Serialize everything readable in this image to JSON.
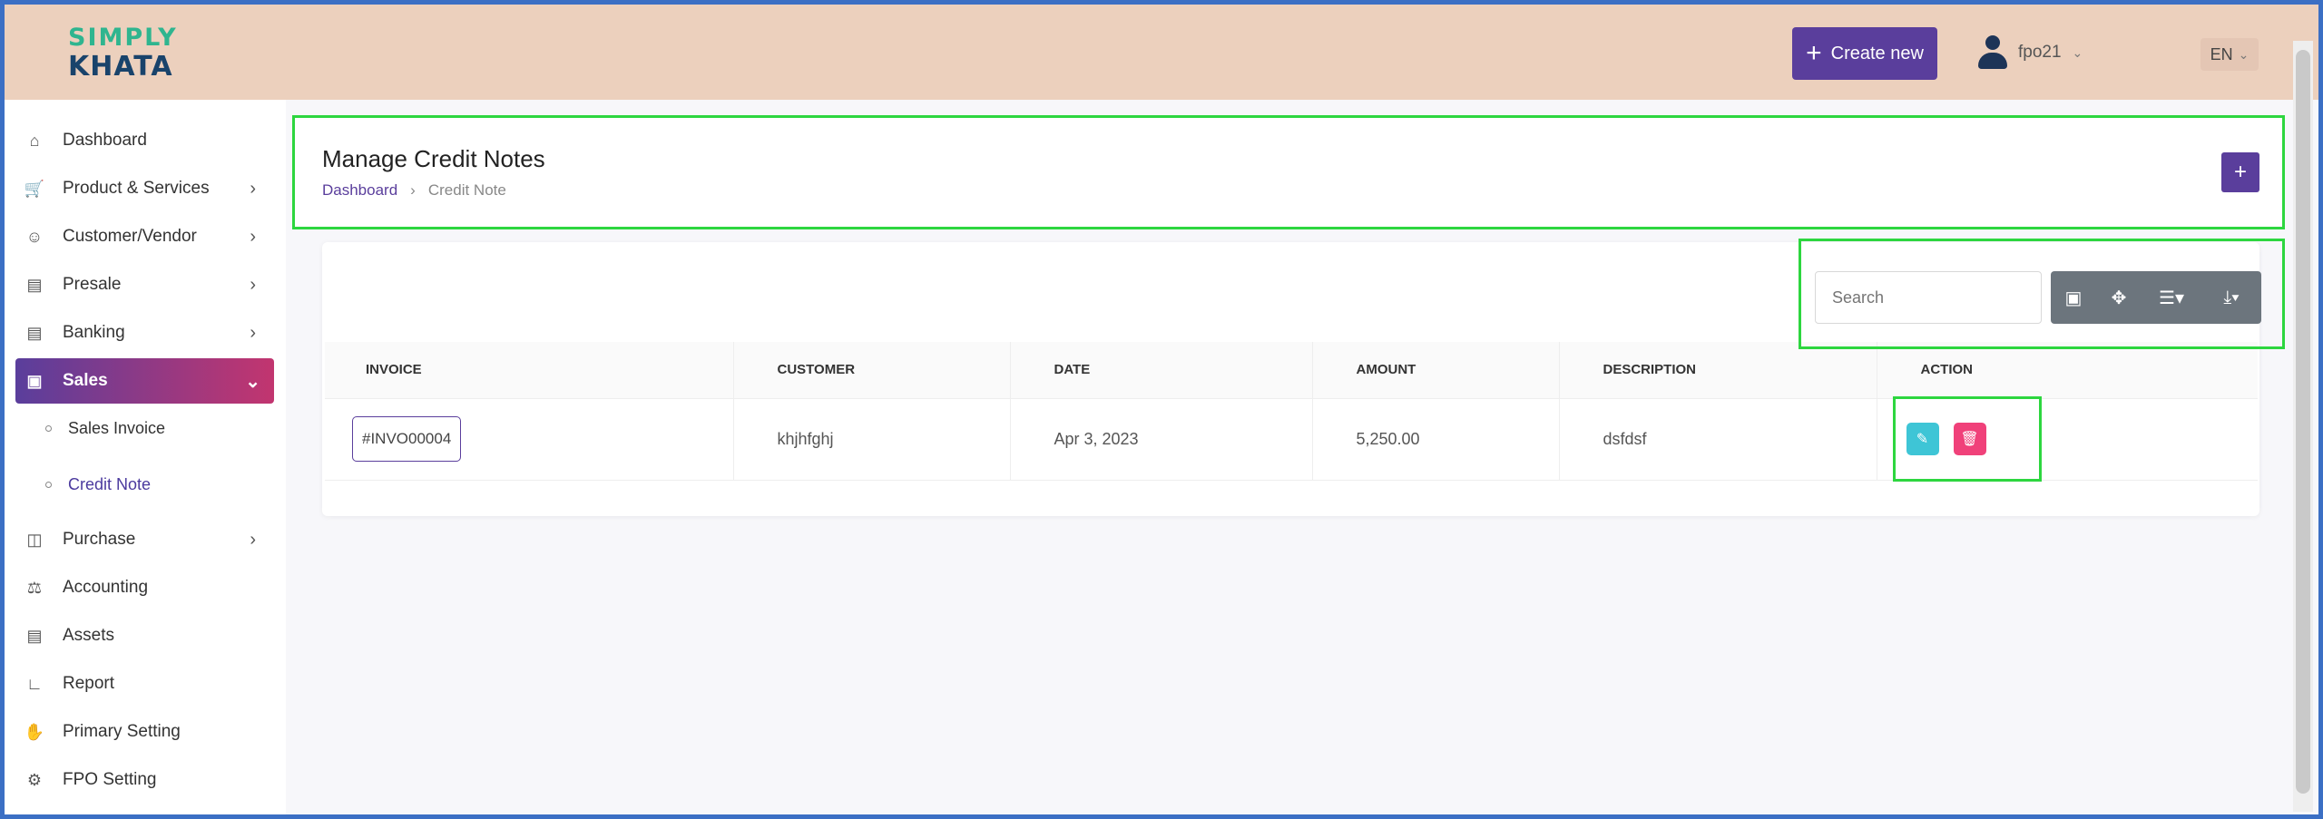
{
  "header": {
    "logo_line1": "SIMPLY",
    "logo_line2": "KHATA",
    "create_label": "Create new",
    "user_name": "fpo21",
    "lang": "EN"
  },
  "sidebar": {
    "items": [
      {
        "label": "Dashboard",
        "icon": "home-icon"
      },
      {
        "label": "Product & Services",
        "icon": "cart-icon"
      },
      {
        "label": "Customer/Vendor",
        "icon": "user-add-icon"
      },
      {
        "label": "Presale",
        "icon": "calculator-icon"
      },
      {
        "label": "Banking",
        "icon": "bank-icon"
      },
      {
        "label": "Sales",
        "icon": "document-icon"
      },
      {
        "label": "Purchase",
        "icon": "receipt-icon"
      },
      {
        "label": "Accounting",
        "icon": "scale-icon"
      },
      {
        "label": "Assets",
        "icon": "clipboard-icon"
      },
      {
        "label": "Report",
        "icon": "chart-icon"
      },
      {
        "label": "Primary Setting",
        "icon": "hand-icon"
      },
      {
        "label": "FPO Setting",
        "icon": "gear-icon"
      }
    ],
    "sub_items": [
      {
        "label": "Sales Invoice"
      },
      {
        "label": "Credit Note"
      }
    ]
  },
  "page": {
    "title": "Manage Credit Notes",
    "breadcrumb": [
      "Dashboard",
      "Credit Note"
    ]
  },
  "search": {
    "placeholder": "Search"
  },
  "table": {
    "headers": [
      "Invoice",
      "Customer",
      "Date",
      "Amount",
      "Description",
      "Action"
    ],
    "rows": [
      {
        "invoice": "#INVO00004",
        "customer": "khjhfghj",
        "date": "Apr 3, 2023",
        "amount": "5,250.00",
        "description": "dsfdsf"
      }
    ]
  },
  "colors": {
    "brand": "#5a3e9c",
    "header_bg": "#ecd0bd",
    "edit": "#3ec5d6",
    "delete": "#f0417a"
  }
}
